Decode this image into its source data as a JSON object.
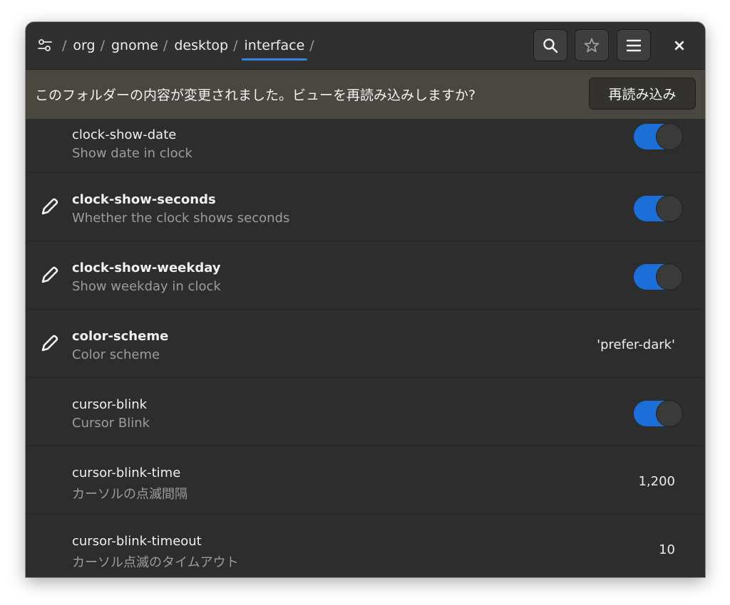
{
  "header": {
    "path_icon": "settings-sliders-icon",
    "crumbs": [
      {
        "label": "org"
      },
      {
        "label": "gnome"
      },
      {
        "label": "desktop"
      },
      {
        "label": "interface"
      }
    ],
    "separator": "/",
    "buttons": {
      "search_icon": "search-icon",
      "bookmark_icon": "star-icon",
      "menu_icon": "hamburger-menu-icon",
      "close_label": "×"
    },
    "active_crumb": "interface",
    "accent_color": "#3584e4"
  },
  "infobar": {
    "message": "このフォルダーの内容が変更されました。ビューを再読み込みしますか?",
    "reload_label": "再読み込み"
  },
  "rows": [
    {
      "key": "clock-show-date",
      "summary": "Show date in clock",
      "modified": false,
      "type": "switch",
      "state": true
    },
    {
      "key": "clock-show-seconds",
      "summary": "Whether the clock shows seconds",
      "modified": true,
      "type": "switch",
      "state": true
    },
    {
      "key": "clock-show-weekday",
      "summary": "Show weekday in clock",
      "modified": true,
      "type": "switch",
      "state": true
    },
    {
      "key": "color-scheme",
      "summary": "Color scheme",
      "modified": true,
      "type": "value",
      "value": "'prefer-dark'"
    },
    {
      "key": "cursor-blink",
      "summary": "Cursor Blink",
      "modified": false,
      "type": "switch",
      "state": true
    },
    {
      "key": "cursor-blink-time",
      "summary": "カーソルの点滅間隔",
      "modified": false,
      "type": "value",
      "value": "1,200"
    },
    {
      "key": "cursor-blink-timeout",
      "summary": "カーソル点滅のタイムアウト",
      "modified": false,
      "type": "value",
      "value": "10"
    }
  ],
  "colors": {
    "switch_on": "#1c6fd9",
    "window_bg": "#2d2d2d",
    "infobar_bg": "#4a4741"
  }
}
